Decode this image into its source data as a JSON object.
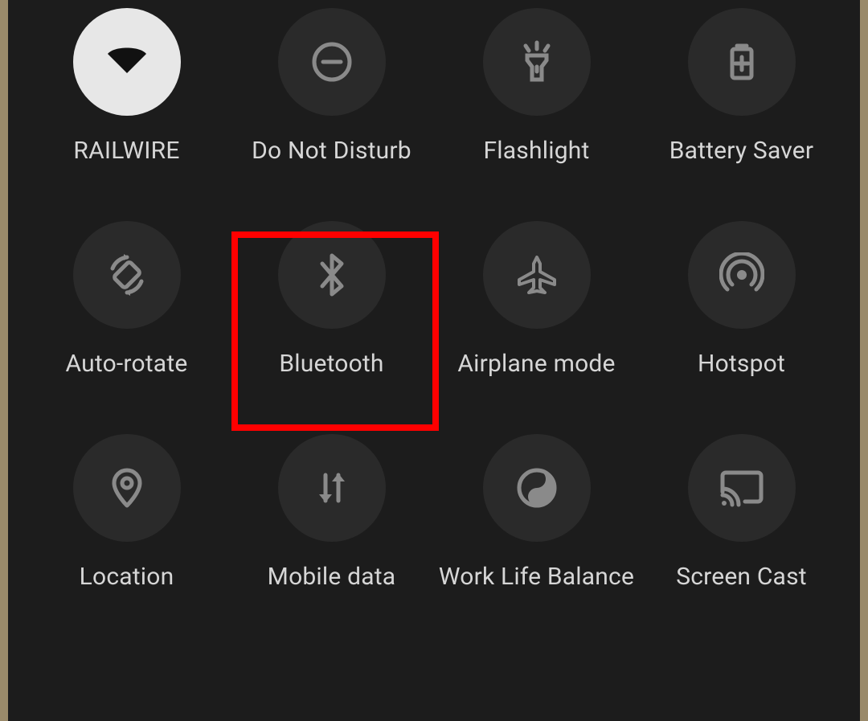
{
  "tiles": [
    {
      "id": "wifi",
      "label": "RAILWIRE",
      "icon": "wifi-icon",
      "active": true
    },
    {
      "id": "dnd",
      "label": "Do Not Disturb",
      "icon": "dnd-icon",
      "active": false
    },
    {
      "id": "flashlight",
      "label": "Flashlight",
      "icon": "flashlight-icon",
      "active": false
    },
    {
      "id": "battery-saver",
      "label": "Battery Saver",
      "icon": "battery-saver-icon",
      "active": false
    },
    {
      "id": "auto-rotate",
      "label": "Auto-rotate",
      "icon": "auto-rotate-icon",
      "active": false
    },
    {
      "id": "bluetooth",
      "label": "Bluetooth",
      "icon": "bluetooth-icon",
      "active": false
    },
    {
      "id": "airplane",
      "label": "Airplane mode",
      "icon": "airplane-icon",
      "active": false
    },
    {
      "id": "hotspot",
      "label": "Hotspot",
      "icon": "hotspot-icon",
      "active": false
    },
    {
      "id": "location",
      "label": "Location",
      "icon": "location-icon",
      "active": false
    },
    {
      "id": "mobile-data",
      "label": "Mobile data",
      "icon": "mobile-data-icon",
      "active": false
    },
    {
      "id": "wlb",
      "label": "Work Life Balance",
      "icon": "wlb-icon",
      "active": false
    },
    {
      "id": "screen-cast",
      "label": "Screen Cast",
      "icon": "screen-cast-icon",
      "active": false
    }
  ],
  "highlight": {
    "target": "bluetooth"
  },
  "colors": {
    "panel_bg": "#1c1c1c",
    "circle_bg": "#2a2a2a",
    "circle_active_bg": "#e7e7e7",
    "icon": "#8a8a8a",
    "label": "#d6d6d6",
    "highlight": "#ff0000"
  }
}
